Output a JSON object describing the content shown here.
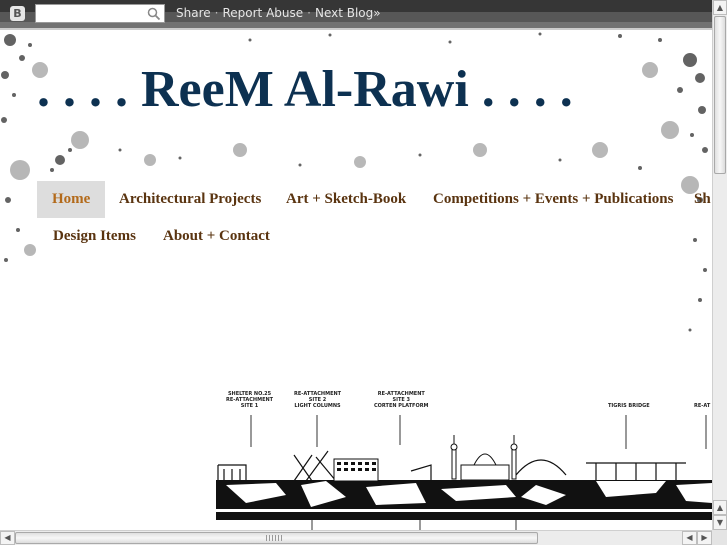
{
  "navbar": {
    "logo": "B",
    "search_placeholder": "",
    "links": [
      "Share",
      "Report Abuse",
      "Next Blog»"
    ]
  },
  "blog": {
    "title": ". . . . ReeM Al-Rawi . . . ."
  },
  "tabs": [
    {
      "label": "Home",
      "active": true
    },
    {
      "label": "Architectural Projects",
      "active": false
    },
    {
      "label": "Art + Sketch-Book",
      "active": false
    },
    {
      "label": "Competitions + Events + Publications",
      "active": false
    },
    {
      "label": "Sh",
      "active": false
    },
    {
      "label": "Design Items",
      "active": false
    },
    {
      "label": "About + Contact",
      "active": false
    }
  ],
  "banner": {
    "labels": [
      "SHELTER NO.25\nRE-ATTACHMENT\nSITE 1",
      "RE-ATTACHMENT\nSITE 2\nLIGHT COLUMNS",
      "RE-ATTACHMENT\nSITE 3\nCORTEN PLATFORM",
      "TIGRIS BRIDGE",
      "RE-AT"
    ]
  },
  "colors": {
    "title": "#0d3151",
    "tab_text": "#5a3410",
    "tab_active_text": "#b36a1a",
    "tab_active_bg": "#dddddd"
  },
  "icons": [
    "blogger-logo-icon",
    "search-icon",
    "scroll-up-icon",
    "scroll-down-icon",
    "scroll-left-icon",
    "scroll-right-icon"
  ]
}
